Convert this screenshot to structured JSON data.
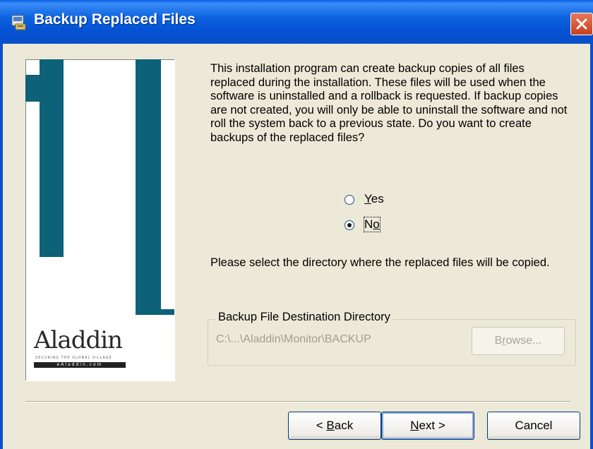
{
  "window": {
    "title": "Backup Replaced Files",
    "title_icon": "installer-icon",
    "close_icon": "close-icon"
  },
  "banner": {
    "logo_text": "Aladdin",
    "logo_tagline": "SECURING THE GLOBAL VILLAGE",
    "logo_url": "eAladdin.com"
  },
  "description": "This installation program can create backup copies of all files replaced during the installation. These files will be used when the software is uninstalled and a rollback is requested.  If backup copies are not created, you will only be able to uninstall the software and not roll the system back to a previous state.  Do you want to create backups of the replaced files?",
  "options": {
    "yes_label": "Yes",
    "no_label": "No",
    "selected": "No"
  },
  "select_directory_text": "Please select the directory where the replaced  files will be copied.",
  "backup_group": {
    "legend": "Backup File Destination Directory",
    "path": "C:\\...\\Aladdin\\Monitor\\BACKUP",
    "browse_label": "Browse..."
  },
  "buttons": {
    "back": "< Back",
    "next": "Next >",
    "cancel": "Cancel"
  }
}
